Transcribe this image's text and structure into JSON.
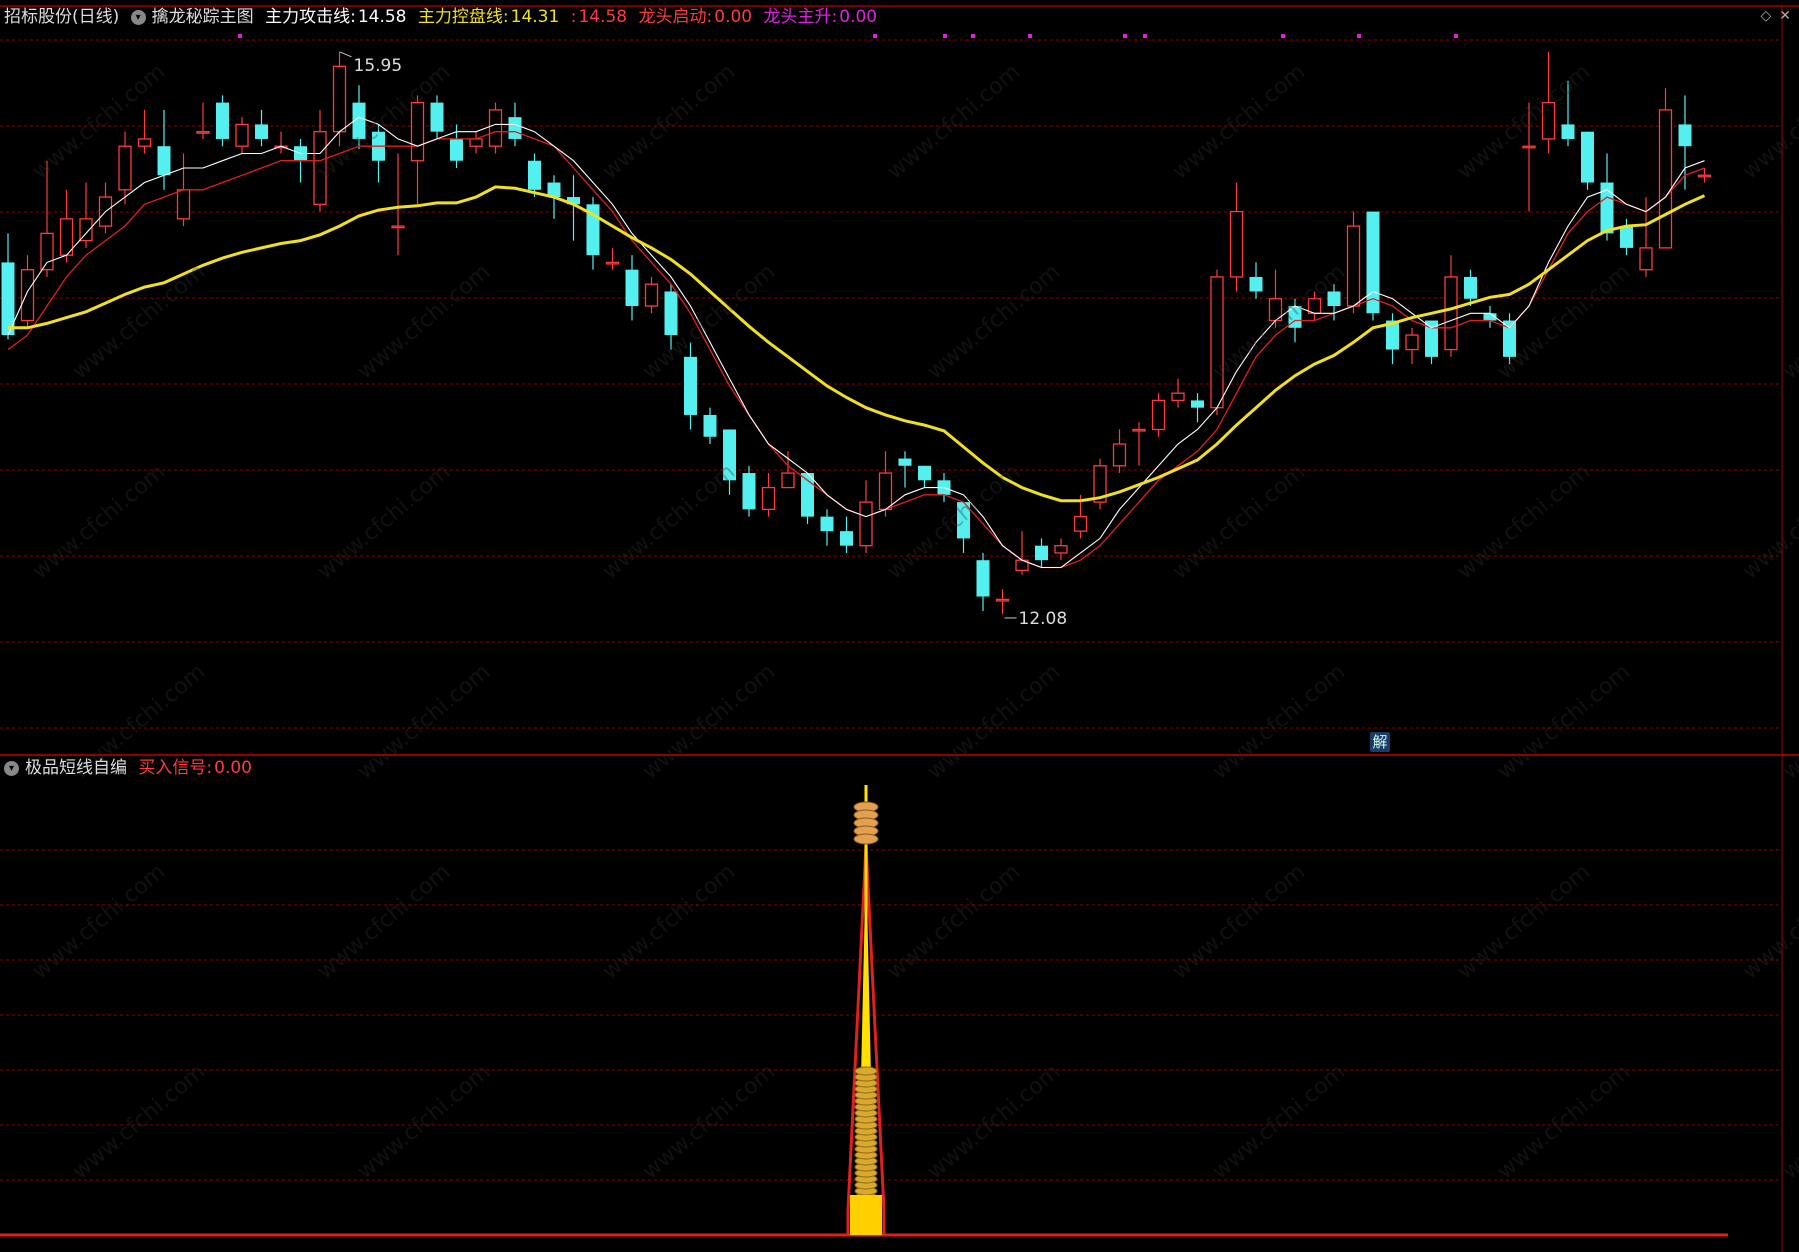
{
  "main_header": {
    "stock_name": "招标股份",
    "period": "(日线)",
    "indicator_name": "擒龙秘踪主图",
    "attack_label": "主力攻击线:",
    "attack_value": "14.58",
    "control_label": "主力控盘线:",
    "control_value": "14.31",
    "sep": ":",
    "third_value": "14.58",
    "start_label": "龙头启动:",
    "start_value": "0.00",
    "rise_label": "龙头主升:",
    "rise_value": "0.00"
  },
  "sub_header": {
    "indicator_name": "极品短线自编",
    "buy_label": "买入信号:",
    "buy_value": "0.00"
  },
  "badge": "解",
  "icons": [
    "diamond-icon",
    "close-icon"
  ],
  "colors": {
    "up": "#ff3b3b",
    "down": "#54f0f0",
    "ma_short": "#ffffff",
    "ma_red": "#e02020",
    "ma_long": "#f0e020",
    "grid": "#8a0000",
    "magenta": "#e020e0"
  },
  "chart_data": [
    {
      "type": "candlestick",
      "title": "擒龙秘踪主图",
      "ylim": [
        11.35,
        16.1
      ],
      "high_label": "15.95",
      "low_label": "12.08",
      "candles": [
        [
          14.5,
          14.0,
          14.7,
          13.97
        ],
        [
          14.1,
          14.45,
          14.55,
          14.05
        ],
        [
          14.45,
          14.7,
          15.2,
          14.4
        ],
        [
          14.55,
          14.8,
          15.0,
          14.5
        ],
        [
          14.65,
          14.8,
          15.05,
          14.6
        ],
        [
          14.75,
          14.95,
          15.05,
          14.7
        ],
        [
          15.0,
          15.3,
          15.4,
          14.9
        ],
        [
          15.3,
          15.35,
          15.55,
          15.25
        ],
        [
          15.3,
          15.1,
          15.55,
          15.0
        ],
        [
          14.8,
          15.0,
          15.25,
          14.75
        ],
        [
          15.4,
          15.4,
          15.6,
          15.35
        ],
        [
          15.6,
          15.35,
          15.65,
          15.3
        ],
        [
          15.3,
          15.45,
          15.5,
          15.25
        ],
        [
          15.45,
          15.35,
          15.55,
          15.3
        ],
        [
          15.3,
          15.3,
          15.4,
          15.25
        ],
        [
          15.3,
          15.2,
          15.35,
          15.05
        ],
        [
          14.9,
          15.4,
          15.55,
          14.85
        ],
        [
          15.4,
          15.85,
          15.95,
          15.3
        ],
        [
          15.6,
          15.35,
          15.72,
          15.28
        ],
        [
          15.4,
          15.2,
          15.45,
          15.05
        ],
        [
          14.75,
          14.75,
          15.25,
          14.55
        ],
        [
          15.2,
          15.6,
          15.65,
          14.9
        ],
        [
          15.6,
          15.4,
          15.65,
          15.35
        ],
        [
          15.35,
          15.2,
          15.45,
          15.15
        ],
        [
          15.3,
          15.35,
          15.4,
          15.25
        ],
        [
          15.3,
          15.55,
          15.6,
          15.25
        ],
        [
          15.5,
          15.35,
          15.6,
          15.3
        ],
        [
          15.2,
          15.0,
          15.25,
          14.95
        ],
        [
          15.05,
          14.95,
          15.1,
          14.8
        ],
        [
          14.95,
          14.9,
          15.1,
          14.65
        ],
        [
          14.9,
          14.55,
          14.95,
          14.45
        ],
        [
          14.5,
          14.5,
          14.6,
          14.45
        ],
        [
          14.45,
          14.2,
          14.55,
          14.1
        ],
        [
          14.2,
          14.35,
          14.4,
          14.15
        ],
        [
          14.3,
          14.0,
          14.35,
          13.9
        ],
        [
          13.85,
          13.45,
          13.95,
          13.35
        ],
        [
          13.45,
          13.3,
          13.5,
          13.25
        ],
        [
          13.35,
          13.0,
          13.35,
          12.9
        ],
        [
          13.05,
          12.8,
          13.1,
          12.75
        ],
        [
          12.8,
          12.95,
          13.05,
          12.75
        ],
        [
          12.95,
          13.05,
          13.2,
          12.95
        ],
        [
          13.05,
          12.75,
          13.05,
          12.7
        ],
        [
          12.75,
          12.65,
          12.8,
          12.55
        ],
        [
          12.65,
          12.55,
          12.75,
          12.5
        ],
        [
          12.55,
          12.85,
          13.0,
          12.5
        ],
        [
          12.8,
          13.05,
          13.2,
          12.75
        ],
        [
          13.15,
          13.1,
          13.2,
          12.95
        ],
        [
          13.1,
          13.0,
          13.1,
          12.95
        ],
        [
          13.0,
          12.9,
          13.05,
          12.85
        ],
        [
          12.85,
          12.6,
          12.85,
          12.5
        ],
        [
          12.45,
          12.2,
          12.5,
          12.1
        ],
        [
          12.18,
          12.18,
          12.25,
          12.08
        ],
        [
          12.38,
          12.45,
          12.65,
          12.35
        ],
        [
          12.55,
          12.45,
          12.6,
          12.4
        ],
        [
          12.5,
          12.55,
          12.6,
          12.45
        ],
        [
          12.65,
          12.75,
          12.9,
          12.6
        ],
        [
          12.85,
          13.1,
          13.15,
          12.8
        ],
        [
          13.1,
          13.25,
          13.35,
          13.05
        ],
        [
          13.35,
          13.35,
          13.4,
          13.1
        ],
        [
          13.35,
          13.55,
          13.6,
          13.3
        ],
        [
          13.55,
          13.6,
          13.7,
          13.5
        ],
        [
          13.55,
          13.5,
          13.6,
          13.4
        ],
        [
          13.5,
          14.4,
          14.45,
          13.45
        ],
        [
          14.4,
          14.85,
          15.05,
          14.3
        ],
        [
          14.4,
          14.3,
          14.5,
          14.25
        ],
        [
          14.1,
          14.25,
          14.45,
          14.05
        ],
        [
          14.2,
          14.05,
          14.25,
          13.95
        ],
        [
          14.15,
          14.25,
          14.3,
          14.1
        ],
        [
          14.3,
          14.2,
          14.35,
          14.1
        ],
        [
          14.2,
          14.75,
          14.85,
          14.15
        ],
        [
          14.85,
          14.15,
          14.85,
          14.1
        ],
        [
          14.1,
          13.9,
          14.15,
          13.8
        ],
        [
          13.9,
          14.0,
          14.05,
          13.8
        ],
        [
          14.1,
          13.85,
          14.1,
          13.8
        ],
        [
          13.9,
          14.4,
          14.55,
          13.85
        ],
        [
          14.4,
          14.25,
          14.45,
          14.2
        ],
        [
          14.15,
          14.1,
          14.2,
          14.05
        ],
        [
          14.1,
          13.85,
          14.15,
          13.8
        ],
        [
          15.3,
          15.3,
          15.6,
          14.85
        ],
        [
          15.35,
          15.6,
          15.95,
          15.25
        ],
        [
          15.45,
          15.35,
          15.75,
          15.3
        ],
        [
          15.4,
          15.05,
          15.4,
          15.0
        ],
        [
          15.05,
          14.7,
          15.25,
          14.65
        ],
        [
          14.75,
          14.6,
          14.8,
          14.55
        ],
        [
          14.45,
          14.6,
          14.95,
          14.4
        ],
        [
          14.6,
          15.55,
          15.7,
          14.6
        ],
        [
          15.45,
          15.3,
          15.65,
          15.0
        ],
        [
          15.1,
          15.1,
          15.15,
          15.05
        ]
      ],
      "ma_short": [
        14.0,
        14.3,
        14.5,
        14.55,
        14.7,
        14.85,
        14.95,
        15.05,
        15.1,
        15.15,
        15.15,
        15.2,
        15.25,
        15.25,
        15.3,
        15.25,
        15.25,
        15.4,
        15.5,
        15.45,
        15.35,
        15.3,
        15.35,
        15.4,
        15.4,
        15.45,
        15.45,
        15.4,
        15.3,
        15.2,
        15.05,
        14.9,
        14.7,
        14.55,
        14.4,
        14.2,
        13.95,
        13.7,
        13.45,
        13.25,
        13.15,
        13.05,
        12.9,
        12.8,
        12.75,
        12.8,
        12.9,
        12.95,
        12.95,
        12.9,
        12.75,
        12.55,
        12.45,
        12.4,
        12.4,
        12.5,
        12.6,
        12.8,
        12.95,
        13.1,
        13.25,
        13.35,
        13.5,
        13.75,
        13.95,
        14.1,
        14.2,
        14.15,
        14.15,
        14.2,
        14.3,
        14.25,
        14.15,
        14.05,
        14.1,
        14.15,
        14.15,
        14.05,
        14.2,
        14.5,
        14.75,
        14.95,
        15.0,
        14.9,
        14.85,
        14.95,
        15.15,
        15.2
      ],
      "ma_red": [
        13.9,
        14.0,
        14.2,
        14.4,
        14.55,
        14.65,
        14.75,
        14.9,
        14.95,
        15.0,
        15.0,
        15.05,
        15.1,
        15.15,
        15.2,
        15.2,
        15.2,
        15.25,
        15.3,
        15.3,
        15.3,
        15.3,
        15.35,
        15.35,
        15.35,
        15.4,
        15.4,
        15.35,
        15.3,
        15.15,
        15.0,
        14.85,
        14.65,
        14.5,
        14.35,
        14.15,
        13.9,
        13.65,
        13.45,
        13.25,
        13.1,
        13.0,
        12.9,
        12.8,
        12.75,
        12.8,
        12.85,
        12.9,
        12.9,
        12.85,
        12.7,
        12.55,
        12.45,
        12.4,
        12.4,
        12.45,
        12.55,
        12.7,
        12.85,
        13.0,
        13.1,
        13.2,
        13.35,
        13.6,
        13.85,
        14.0,
        14.1,
        14.1,
        14.15,
        14.2,
        14.25,
        14.2,
        14.1,
        14.05,
        14.05,
        14.1,
        14.1,
        14.05,
        14.2,
        14.45,
        14.7,
        14.85,
        14.95,
        14.9,
        14.85,
        14.95,
        15.1,
        15.15
      ],
      "ma_long": [
        14.05,
        14.05,
        14.08,
        14.12,
        14.16,
        14.22,
        14.28,
        14.33,
        14.36,
        14.42,
        14.48,
        14.53,
        14.57,
        14.6,
        14.63,
        14.65,
        14.69,
        14.75,
        14.82,
        14.86,
        14.88,
        14.89,
        14.91,
        14.91,
        14.95,
        15.02,
        15.01,
        14.98,
        14.95,
        14.9,
        14.83,
        14.75,
        14.67,
        14.6,
        14.52,
        14.42,
        14.3,
        14.18,
        14.06,
        13.95,
        13.85,
        13.75,
        13.65,
        13.57,
        13.5,
        13.45,
        13.41,
        13.38,
        13.34,
        13.23,
        13.12,
        13.02,
        12.95,
        12.9,
        12.86,
        12.86,
        12.88,
        12.92,
        12.97,
        13.02,
        13.08,
        13.14,
        13.25,
        13.38,
        13.5,
        13.62,
        13.72,
        13.8,
        13.86,
        13.95,
        14.05,
        14.08,
        14.12,
        14.15,
        14.18,
        14.22,
        14.26,
        14.28,
        14.35,
        14.45,
        14.55,
        14.65,
        14.72,
        14.75,
        14.76,
        14.83,
        14.9,
        14.96
      ]
    },
    {
      "type": "bar",
      "title": "极品短线自编",
      "series_name": "买入信号",
      "ylim": [
        0,
        1
      ],
      "signal_index": 44,
      "signal_value": 1.0
    }
  ]
}
